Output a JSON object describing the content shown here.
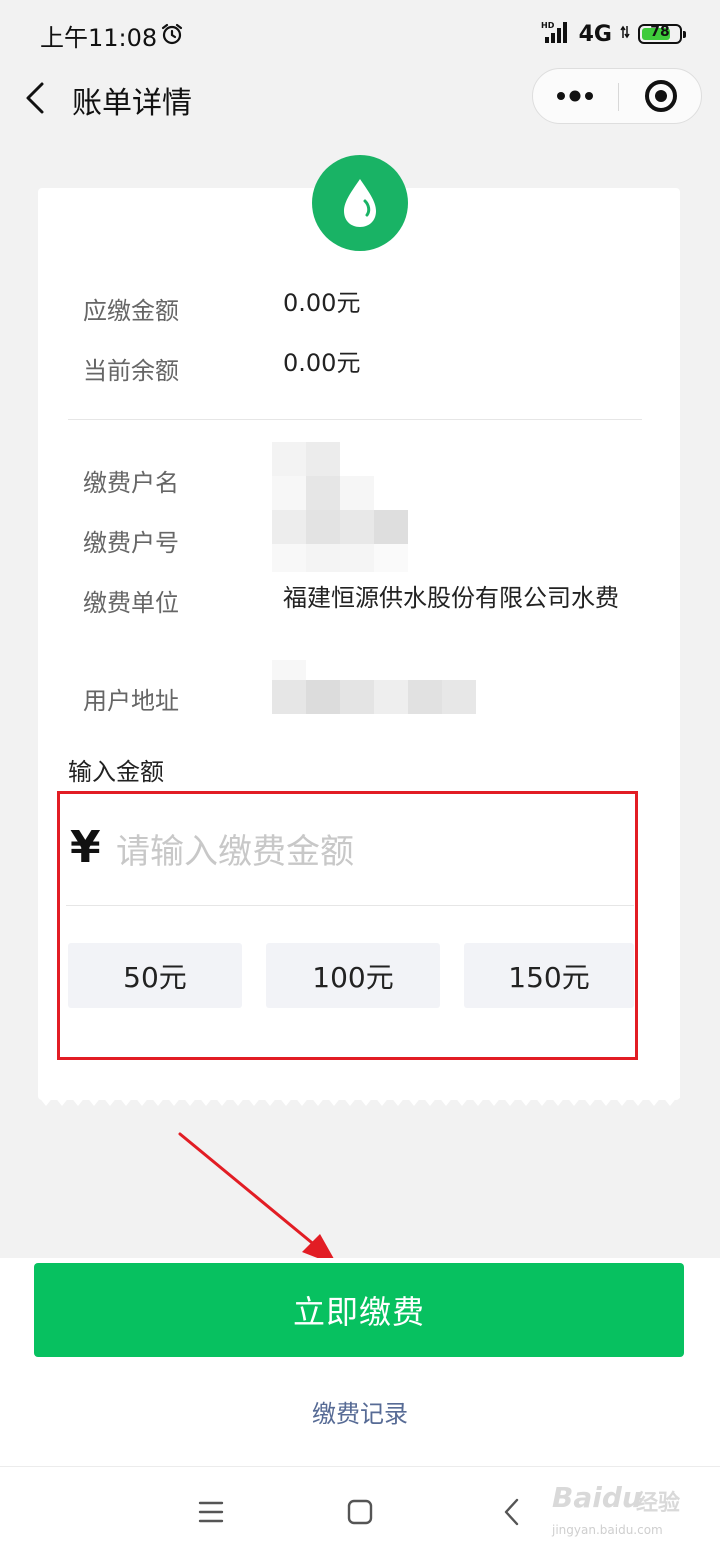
{
  "status_bar": {
    "time": "上午11:08",
    "network": "4G",
    "battery": "78",
    "battery_level_percent": 78
  },
  "nav": {
    "title": "账单详情"
  },
  "bill": {
    "rows": [
      {
        "label": "应缴金额",
        "value": "0.00元"
      },
      {
        "label": "当前余额",
        "value": "0.00元"
      },
      {
        "label": "缴费户名",
        "value": ""
      },
      {
        "label": "缴费户号",
        "value": ""
      },
      {
        "label": "缴费单位",
        "value": "福建恒源供水股份有限公司水费"
      },
      {
        "label": "用户地址",
        "value": ""
      }
    ]
  },
  "amount_input": {
    "label": "输入金额",
    "currency_symbol": "¥",
    "value": "",
    "placeholder": "请输入缴费金额"
  },
  "quick_amounts": [
    "50元",
    "100元",
    "150元"
  ],
  "actions": {
    "pay_label": "立即缴费",
    "records_label": "缴费记录"
  },
  "watermark": {
    "brand": "Baidu",
    "brand_cn": "经验",
    "url": "jingyan.baidu.com"
  },
  "colors": {
    "primary_green": "#07c160",
    "logo_green": "#19b365",
    "link_blue": "#576b95",
    "highlight_red": "#e21d24"
  }
}
